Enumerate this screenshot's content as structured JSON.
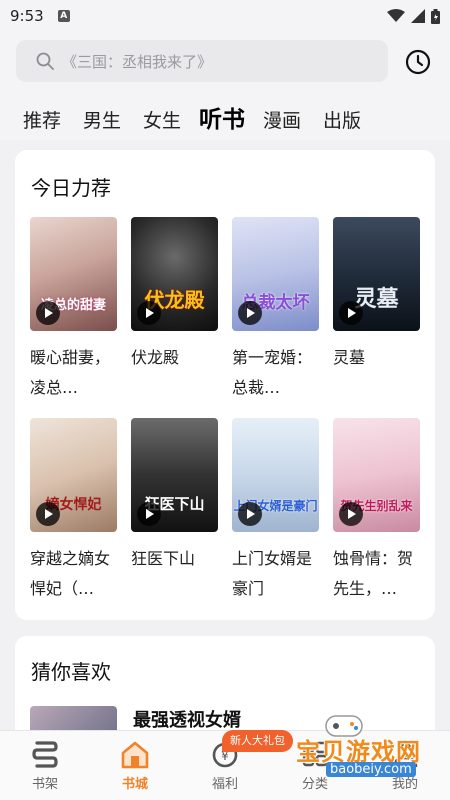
{
  "status_bar": {
    "time": "9:53"
  },
  "search": {
    "placeholder": "《三国：丞相我来了》"
  },
  "tabs": [
    "推荐",
    "男生",
    "女生",
    "听书",
    "漫画",
    "出版"
  ],
  "active_tab": "听书",
  "section_recommend": {
    "title": "今日力荐",
    "books": [
      {
        "name": "暖心甜妻，凌总…",
        "cover_text": "凌总的甜妻"
      },
      {
        "name": "伏龙殿",
        "cover_text": "伏龙殿"
      },
      {
        "name": "第一宠婚：总裁…",
        "cover_text": "总裁太坏"
      },
      {
        "name": "灵墓",
        "cover_text": "灵墓"
      },
      {
        "name": "穿越之嫡女悍妃（…",
        "cover_text": "嫡女悍妃"
      },
      {
        "name": "狂医下山",
        "cover_text": "狂医下山"
      },
      {
        "name": "上门女婿是豪门",
        "cover_text": "上门女婿是豪门"
      },
      {
        "name": "蚀骨情：贺先生，…",
        "cover_text": "贺先生别乱来"
      }
    ]
  },
  "section_guess": {
    "title": "猜你喜欢",
    "first_item": "最强透视女婿"
  },
  "bottom_nav": [
    {
      "label": "书架",
      "icon": "bookshelf-icon"
    },
    {
      "label": "书城",
      "icon": "bookstore-icon"
    },
    {
      "label": "福利",
      "icon": "welfare-icon"
    },
    {
      "label": "分类",
      "icon": "category-icon"
    },
    {
      "label": "我的",
      "icon": "profile-icon"
    }
  ],
  "promo_badge": "新人大礼包",
  "watermark": {
    "title": "宝贝游戏网",
    "url": "baobeiy.com"
  },
  "colors": {
    "accent": "#f2822a",
    "promo": "#f0612b",
    "background": "#f1f1f3"
  }
}
